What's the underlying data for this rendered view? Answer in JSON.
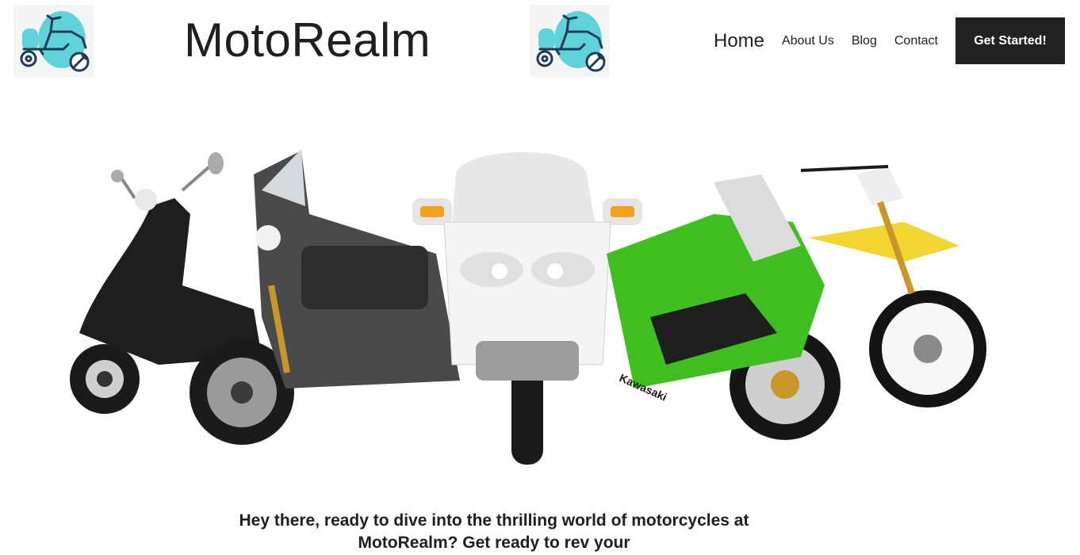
{
  "header": {
    "brand": "MotoRealm",
    "logo_icon": "scooter-wrench-icon",
    "colors": {
      "logo_accent": "#5fd3d9",
      "logo_stroke": "#1f3b57"
    }
  },
  "nav": {
    "items": [
      {
        "label": "Home"
      },
      {
        "label": "About Us"
      },
      {
        "label": "Blog"
      },
      {
        "label": "Contact"
      }
    ],
    "cta_label": "Get Started!",
    "colors": {
      "cta_bg": "#222222",
      "cta_text": "#ffffff"
    }
  },
  "hero": {
    "image_icon": "motorcycle-lineup-image",
    "brand_on_bike": "Kawasaki",
    "colors": {
      "green_bike": "#3fbf1f",
      "yellow_bike": "#f2d531"
    }
  },
  "intro": {
    "text": "Hey there, ready to dive into the thrilling world of motorcycles at MotoRealm? Get ready to rev your"
  }
}
